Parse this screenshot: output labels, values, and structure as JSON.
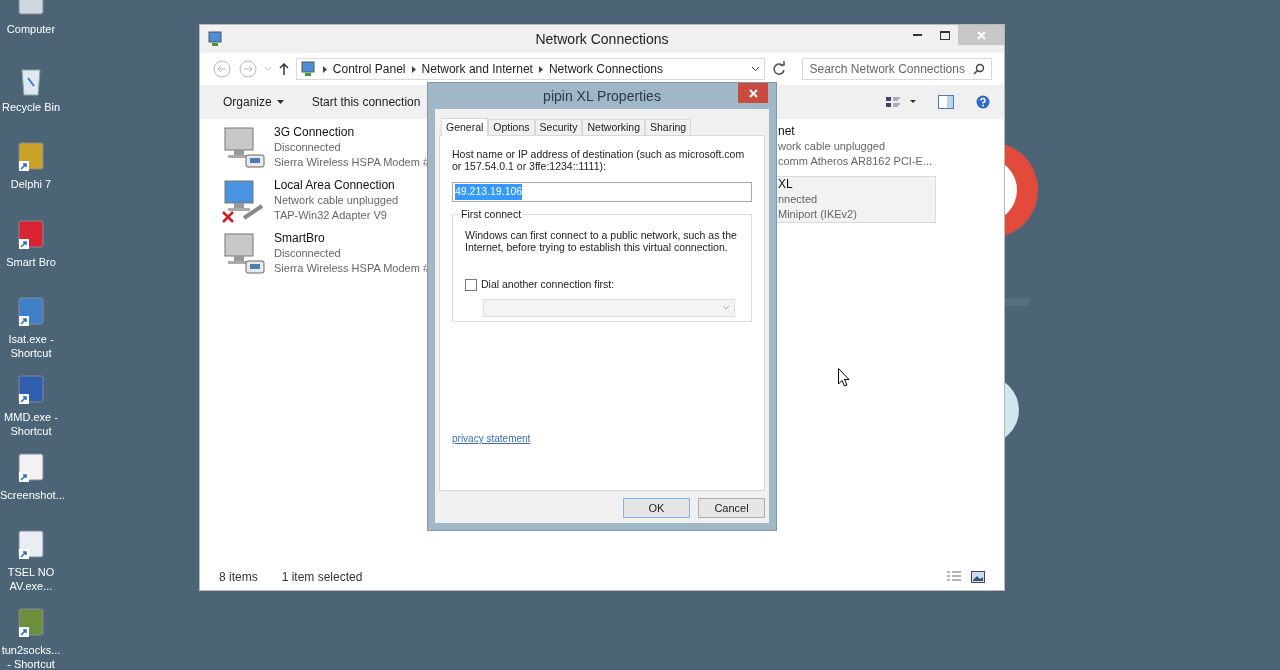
{
  "desktop_icons": [
    {
      "label": "Computer"
    },
    {
      "label": "Recycle Bin"
    },
    {
      "label": "Delphi 7"
    },
    {
      "label": "Smart Bro"
    },
    {
      "label": "Isat.exe - Shortcut"
    },
    {
      "label": "MMD.exe - Shortcut"
    },
    {
      "label": "Screenshot..."
    },
    {
      "label": "TSEL NO AV.exe..."
    },
    {
      "label": "tun2socks... - Shortcut"
    }
  ],
  "explorer": {
    "title": "Network Connections",
    "breadcrumb": [
      "Control Panel",
      "Network and Internet",
      "Network Connections"
    ],
    "search": {
      "placeholder": "Search Network Connections"
    },
    "commands": [
      "Organize",
      "Start this connection"
    ],
    "connections": [
      {
        "name": "3G Connection",
        "status": "Disconnected",
        "device": "Sierra Wireless HSPA Modem #",
        "kind": "modem",
        "error": false
      },
      {
        "name": "Local Area Connection",
        "status": "Network cable unplugged",
        "device": "TAP-Win32 Adapter V9",
        "kind": "lan",
        "error": true
      },
      {
        "name": "SmartBro",
        "status": "Disconnected",
        "device": "Sierra Wireless HSPA Modem #",
        "kind": "modem",
        "error": false
      }
    ],
    "right_items": [
      {
        "name": "net",
        "status": "work cable unplugged",
        "device": "comm Atheros AR8162 PCI-E...",
        "selected": false
      },
      {
        "name": "XL",
        "status": "nnected",
        "device": "Miniport (IKEv2)",
        "selected": true
      }
    ],
    "status_bar": {
      "count": "8 items",
      "selection": "1 item selected"
    }
  },
  "dialog": {
    "title": "pipin XL Properties",
    "tabs": [
      {
        "label": "General",
        "selected": true
      },
      {
        "label": "Options",
        "selected": false
      },
      {
        "label": "Security",
        "selected": false
      },
      {
        "label": "Networking",
        "selected": false
      },
      {
        "label": "Sharing",
        "selected": false
      }
    ],
    "host_label": "Host name or IP address of destination (such as microsoft.com or 157.54.0.1 or 3ffe:1234::1111):",
    "host_value": "49.213.19.106",
    "host_value_selected": true,
    "group_title": "First connect",
    "description": "Windows can first connect to a public network, such as the Internet, before trying to establish this virtual connection.",
    "checkbox": {
      "label": "Dial another connection first:",
      "checked": false
    },
    "dropdown": {
      "disabled": true
    },
    "link": "privacy statement",
    "buttons": [
      "OK",
      "Cancel"
    ]
  }
}
